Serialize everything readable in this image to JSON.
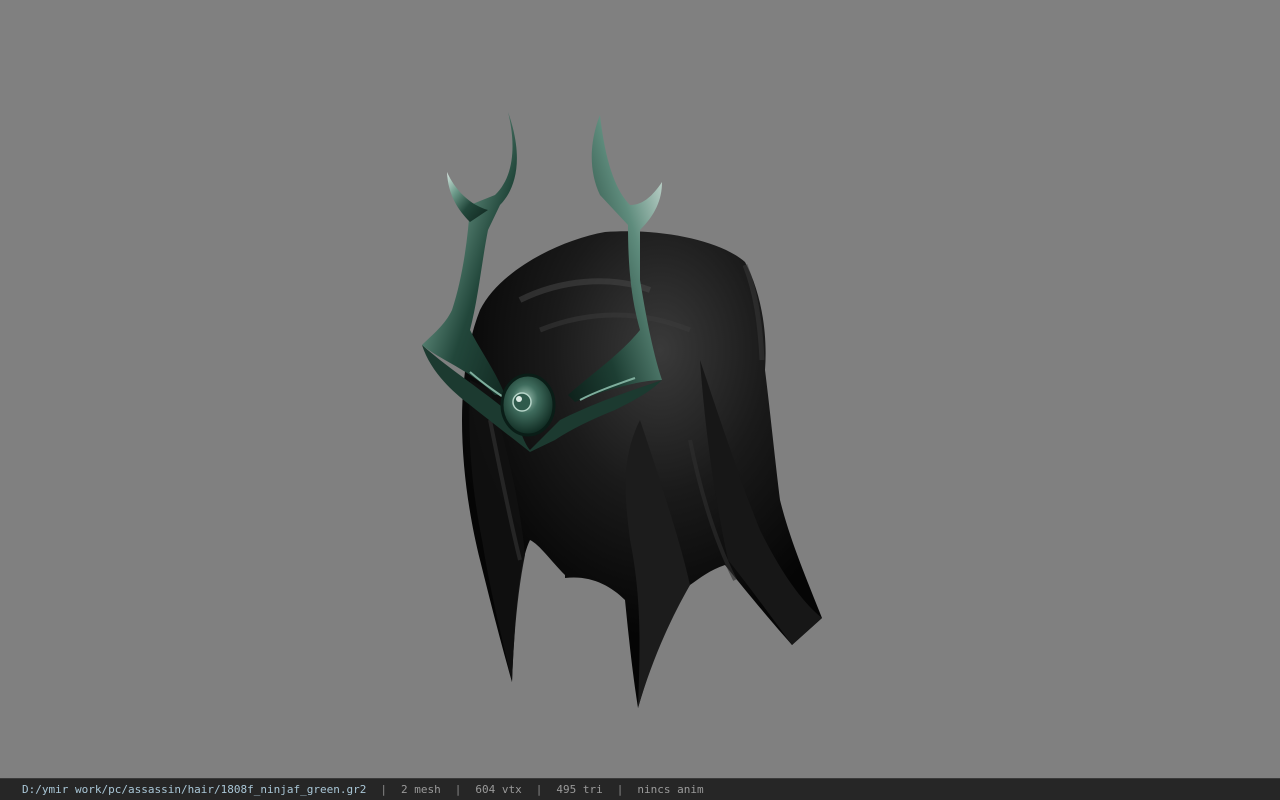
{
  "viewer": {
    "background_color": "#808080",
    "model": {
      "hair_color": "#0c0c0c",
      "crown_color": "#2f5a4c",
      "icon": "hair-with-crown-model"
    }
  },
  "status": {
    "file_path": "D:/ymir work/pc/assassin/hair/1808f_ninjaf_green.gr2",
    "separator": "|",
    "mesh": "2 mesh",
    "vtx": "604 vtx",
    "tri": "495 tri",
    "anim": "nincs anim"
  }
}
